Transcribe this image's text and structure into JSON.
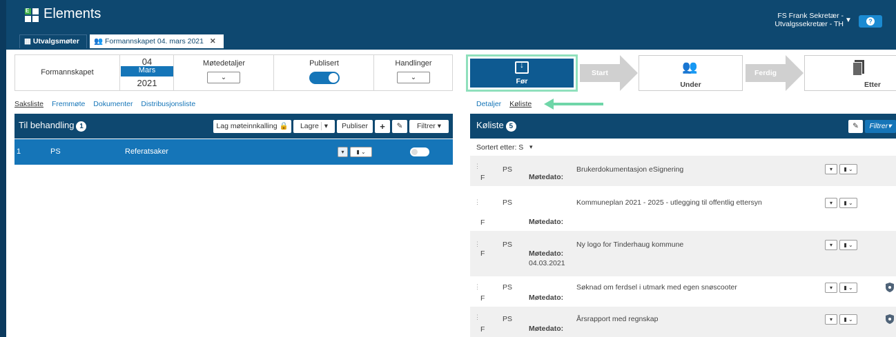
{
  "app": {
    "title": "Elements"
  },
  "tabs": [
    {
      "label": "Utvalgsmøter"
    },
    {
      "label": "Formannskapet 04. mars 2021"
    }
  ],
  "user": {
    "line1": "FS Frank Sekretær -",
    "line2": "Utvalgssekretær - TH"
  },
  "meeting": {
    "committee": "Formannskapet",
    "day": "04",
    "month": "Mars",
    "year": "2021",
    "details_label": "Møtedetaljer",
    "published_label": "Publisert",
    "published": true,
    "actions_label": "Handlinger"
  },
  "left_tabs": [
    "Saksliste",
    "Fremmøte",
    "Dokumenter",
    "Distribusjonsliste"
  ],
  "left_panel": {
    "title": "Til behandling",
    "count": "1",
    "buttons": {
      "invite": "Lag møteinnkalling",
      "save": "Lagre",
      "publish": "Publiser",
      "filter": "Filtrer"
    },
    "rows": [
      {
        "num": "1",
        "type": "PS",
        "title": "Referatsaker"
      }
    ]
  },
  "stages": {
    "before": "Før",
    "start": "Start",
    "during": "Under",
    "done": "Ferdig",
    "after": "Etter"
  },
  "right_tabs": [
    "Detaljer",
    "Køliste"
  ],
  "right_panel": {
    "title": "Køliste",
    "count": "5",
    "filter": "Filtrer",
    "sort_label": "Sortert etter: S",
    "date_label": "Møtedato:",
    "rows": [
      {
        "flag": "F",
        "type": "PS",
        "title": "Brukerdokumentasjon eSignering",
        "date": ""
      },
      {
        "flag": "F",
        "type": "PS",
        "title": "Kommuneplan 2021 - 2025 - utlegging til offentlig ettersyn",
        "date": ""
      },
      {
        "flag": "F",
        "type": "PS",
        "title": "Ny logo for Tinderhaug kommune",
        "date": "04.03.2021"
      },
      {
        "flag": "F",
        "type": "PS",
        "title": "Søknad om ferdsel i utmark med egen snøscooter",
        "date": ""
      },
      {
        "flag": "F",
        "type": "PS",
        "title": "Årsrapport med regnskap",
        "date": ""
      }
    ]
  },
  "colors": {
    "header": "#0e4870",
    "accent": "#1575b8",
    "highlight": "#5fd3a0"
  }
}
